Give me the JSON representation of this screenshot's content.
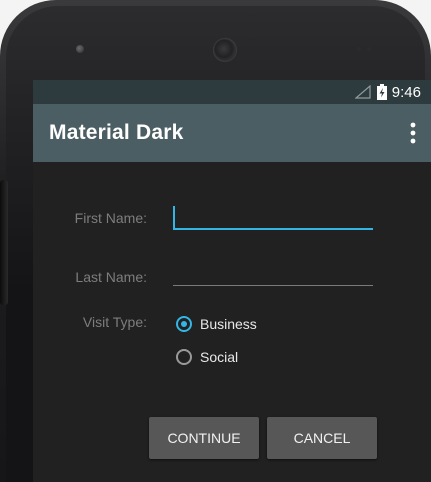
{
  "statusbar": {
    "time": "9:46",
    "signal_icon": "no-signal-icon",
    "battery_icon": "battery-charging-icon"
  },
  "actionbar": {
    "title": "Material Dark",
    "menu_icon": "overflow-menu-icon"
  },
  "form": {
    "first_name_label": "First Name:",
    "first_name_value": "",
    "last_name_label": "Last Name:",
    "last_name_value": "",
    "visit_type_label": "Visit Type:",
    "visit_options": [
      {
        "label": "Business",
        "checked": true
      },
      {
        "label": "Social",
        "checked": false
      }
    ]
  },
  "buttons": {
    "continue": "CONTINUE",
    "cancel": "CANCEL"
  },
  "colors": {
    "accent": "#33b5e5",
    "actionbar": "#4b5e63",
    "statusbar": "#2d3a3e",
    "background": "#212121",
    "button": "#575757"
  }
}
